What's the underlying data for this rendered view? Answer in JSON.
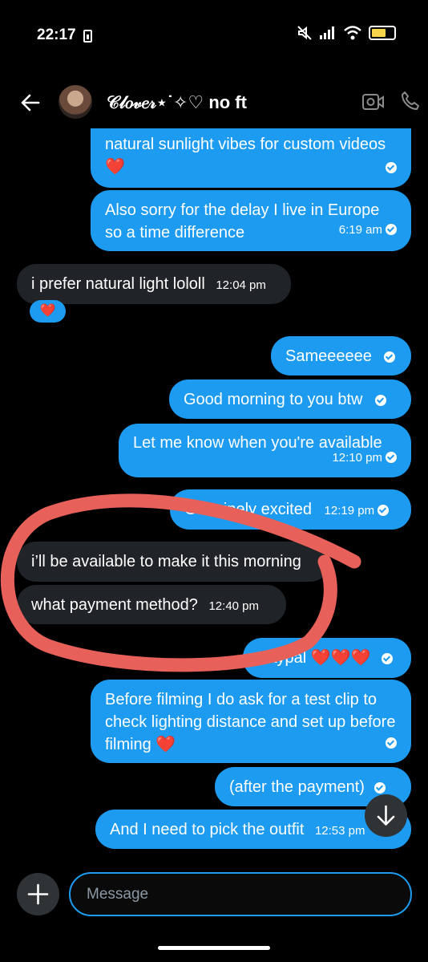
{
  "status_bar": {
    "time": "22:17"
  },
  "header": {
    "contact_name": "𝒞𝓁𝑜𝓋𝑒𝓇⋆˙✧♡ no ft"
  },
  "messages": [
    {
      "id": "m1",
      "direction": "outgoing",
      "text": "natural sunlight vibes for custom videos ❤️",
      "time": ""
    },
    {
      "id": "m2",
      "direction": "outgoing",
      "text": "Also sorry for the delay I live in Europe so a time difference",
      "time": "6:19 am"
    },
    {
      "id": "m3",
      "direction": "incoming",
      "text": "i prefer natural light lololl",
      "time": "12:04 pm",
      "reaction": "❤️"
    },
    {
      "id": "m4",
      "direction": "outgoing",
      "text": "Sameeeeee",
      "time": ""
    },
    {
      "id": "m5",
      "direction": "outgoing",
      "text": "Good morning to you btw",
      "time": ""
    },
    {
      "id": "m6",
      "direction": "outgoing",
      "text": "Let me know when you're available",
      "time": "12:10 pm"
    },
    {
      "id": "m7",
      "direction": "outgoing",
      "text": "Genuinely excited",
      "time": "12:19 pm"
    },
    {
      "id": "m8",
      "direction": "incoming",
      "text": "i’ll be available to make it this morning",
      "time": ""
    },
    {
      "id": "m9",
      "direction": "incoming",
      "text": "what payment method?",
      "time": "12:40 pm"
    },
    {
      "id": "m10",
      "direction": "outgoing",
      "text": "Paypal ❤️❤️❤️",
      "time": ""
    },
    {
      "id": "m11",
      "direction": "outgoing",
      "text": "Before filming I do ask for a test clip to check lighting distance and set up before filming ❤️",
      "time": ""
    },
    {
      "id": "m12",
      "direction": "outgoing",
      "text": "(after the payment)",
      "time": ""
    },
    {
      "id": "m13",
      "direction": "outgoing",
      "text": "And I need to pick the outfit",
      "time": "12:53 pm"
    }
  ],
  "composer": {
    "placeholder": "Message"
  },
  "colors": {
    "outgoing_bubble": "#1d9bf0",
    "incoming_bubble": "#202327",
    "annotation_circle": "#e8605a",
    "background": "#000000"
  },
  "icons": [
    "back-arrow-icon",
    "video-call-icon",
    "phone-icon",
    "plus-icon",
    "arrow-down-icon"
  ]
}
